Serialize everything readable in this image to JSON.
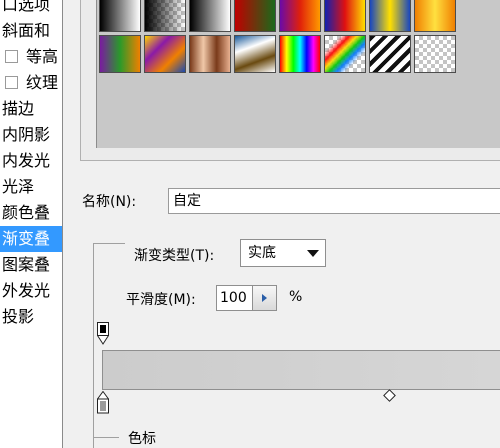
{
  "style_list": {
    "items": [
      {
        "label": "口选项",
        "checkbox": false,
        "selected": false
      },
      {
        "label": "斜面和",
        "checkbox": false,
        "selected": false
      },
      {
        "label": "等高",
        "checkbox": true,
        "selected": false
      },
      {
        "label": "纹理",
        "checkbox": true,
        "selected": false
      },
      {
        "label": "描边",
        "checkbox": false,
        "selected": false
      },
      {
        "label": "内阴影",
        "checkbox": false,
        "selected": false
      },
      {
        "label": "内发光",
        "checkbox": false,
        "selected": false
      },
      {
        "label": "光泽",
        "checkbox": false,
        "selected": false
      },
      {
        "label": "颜色叠",
        "checkbox": false,
        "selected": false
      },
      {
        "label": "渐变叠",
        "checkbox": false,
        "selected": true
      },
      {
        "label": "图案叠",
        "checkbox": false,
        "selected": false
      },
      {
        "label": "外发光",
        "checkbox": false,
        "selected": false
      },
      {
        "label": "投影",
        "checkbox": false,
        "selected": false
      }
    ]
  },
  "presets": [
    {
      "name": "black-white",
      "style": "linear-gradient(to right,#000000,#ffffff)"
    },
    {
      "name": "black-transparent",
      "style": "checker-black"
    },
    {
      "name": "black-white-diag",
      "style": "linear-gradient(to right,#000,#fff)"
    },
    {
      "name": "red-green",
      "style": "linear-gradient(to right,#c00000,#1a6a1a)"
    },
    {
      "name": "violet-orange",
      "style": "linear-gradient(to right,#6a0aa8,#e0200a,#ff9a00)"
    },
    {
      "name": "blue-red-yellow",
      "style": "linear-gradient(to right,#1020b0,#e01010,#ffe000)"
    },
    {
      "name": "blue-yellow-blue",
      "style": "linear-gradient(to right,#1846c0,#ffe000,#1846c0)"
    },
    {
      "name": "orange-yellow-orange",
      "style": "linear-gradient(to right,#f08000,#ffe040,#f08000)"
    },
    {
      "name": "violet-green-orange",
      "style": "linear-gradient(to right,#7a1aa0,#2a9a2a,#f08000)"
    },
    {
      "name": "yellow-violet-orange-blue",
      "style": "linear-gradient(135deg,#ffd400,#8a1aa8,#f08000,#1a4ab0)"
    },
    {
      "name": "copper",
      "style": "linear-gradient(to right,#7a3a1a,#f0c8a8,#7a3a1a,#e8b090)"
    },
    {
      "name": "chrome",
      "style": "linear-gradient(160deg,#1a5a9a,#ffffff,#6a4a10,#ffffff)"
    },
    {
      "name": "spectrum",
      "style": "linear-gradient(to right,#ff0000,#ffff00,#00ff00,#00ffff,#0000ff,#ff00ff,#ff0000)"
    },
    {
      "name": "transparent-rainbow",
      "style": "checker-rainbow"
    },
    {
      "name": "transparent-stripes",
      "style": "repeating-linear-gradient(135deg,#111 0 4px,#fff 4px 9px)"
    },
    {
      "name": "transparent",
      "style": "checker"
    }
  ],
  "name_field": {
    "label": "名称(N):",
    "value": "自定"
  },
  "gradient_type": {
    "label": "渐变类型(T):",
    "value": "实底"
  },
  "smoothness": {
    "label": "平滑度(M):",
    "value": "100",
    "unit": "%"
  },
  "color_stops_group": {
    "title": "色标"
  }
}
